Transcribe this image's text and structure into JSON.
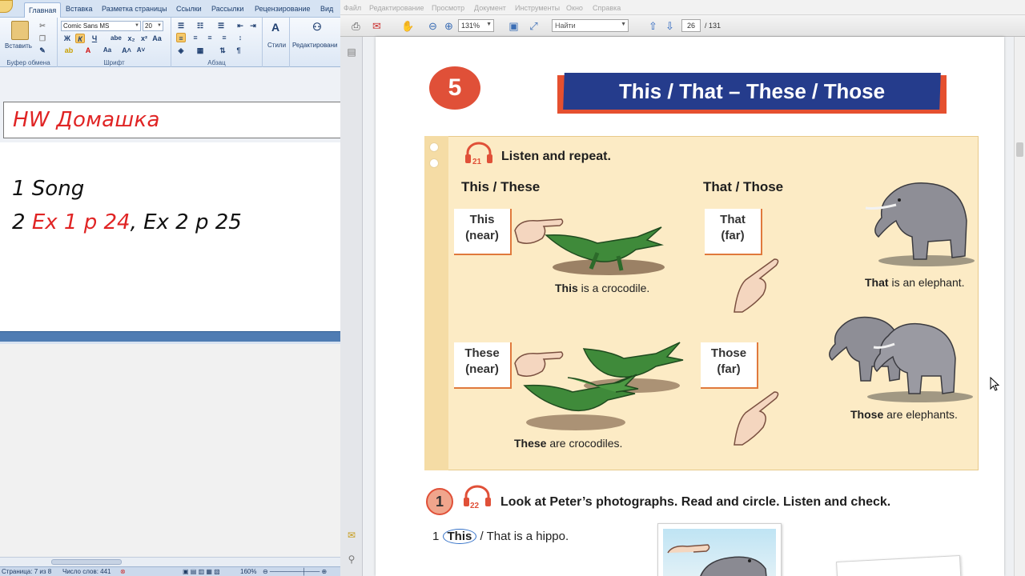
{
  "word": {
    "tabs": [
      "Главная",
      "Вставка",
      "Разметка страницы",
      "Ссылки",
      "Рассылки",
      "Рецензирование",
      "Вид"
    ],
    "active_tab": "Главная",
    "clipboard": {
      "paste_label": "Вставить",
      "group_label": "Буфер обмена"
    },
    "font": {
      "name": "Comic Sans MS",
      "size": "20",
      "group_label": "Шрифт"
    },
    "paragraph": {
      "group_label": "Абзац"
    },
    "styles": {
      "label": "Стили"
    },
    "editing": {
      "label": "Редактировани"
    },
    "doc": {
      "title_box": "HW Домашка",
      "line1": "1 Song",
      "line2_num": "2 ",
      "line2_red": "Ex 1 p 24",
      "line2_rest": ", Ex 2 p 25"
    },
    "status": {
      "page": "Страница: 7 из 8",
      "words": "Число слов: 441",
      "zoom": "160%"
    }
  },
  "pdf": {
    "menu": [
      "Файл",
      "Редактирование",
      "Просмотр",
      "Документ",
      "Инструменты",
      "Окно",
      "Справка"
    ],
    "zoom": "131%",
    "find_placeholder": "Найти",
    "page_current": "26",
    "page_total": "/ 131",
    "book": {
      "unit": "5",
      "title": "This / That – These / Those",
      "track1": "21",
      "instruction1": "Listen and repeat.",
      "col1_head": "This / These",
      "col2_head": "That / Those",
      "label_this": [
        "This",
        "(near)"
      ],
      "label_that": [
        "That",
        "(far)"
      ],
      "label_these": [
        "These",
        "(near)"
      ],
      "label_those": [
        "Those",
        "(far)"
      ],
      "cap_croc": {
        "b": "This",
        "rest": " is a crocodile."
      },
      "cap_eleph": {
        "b": "That",
        "rest": " is an elephant."
      },
      "cap_crocs": {
        "b": "These",
        "rest": " are crocodiles."
      },
      "cap_elephs": {
        "b": "Those",
        "rest": " are elephants."
      },
      "ex_num": "1",
      "track2": "22",
      "instruction2": "Look at Peter’s photographs. Read and circle. Listen and check.",
      "ex1_num": "1 ",
      "ex1_circled": "This",
      "ex1_rest": " / That is a hippo."
    }
  },
  "colors": {
    "accent_red": "#e05038",
    "banner_blue": "#253c8c",
    "word_red": "#e02424",
    "panel": "#fcebc5"
  }
}
